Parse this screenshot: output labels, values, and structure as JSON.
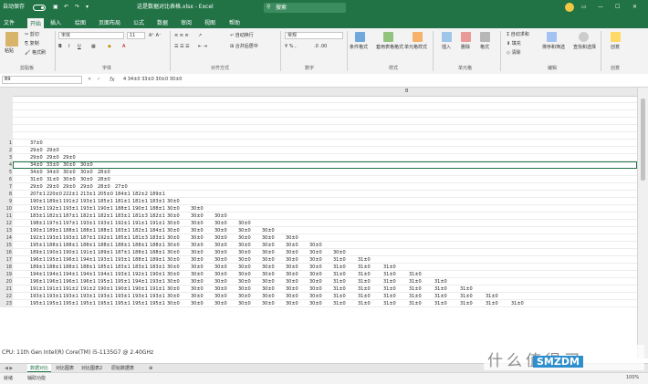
{
  "window": {
    "title_left": "自动保存",
    "title_center": "这是数据对比表格.xlsx - Excel",
    "search_placeholder": "搜索",
    "colors": {
      "brand": "#217346",
      "accent": "#f2c744"
    }
  },
  "menu": {
    "items": [
      "文件",
      "开始",
      "插入",
      "绘图",
      "页面布局",
      "公式",
      "数据",
      "审阅",
      "视图",
      "帮助"
    ],
    "active": "开始"
  },
  "ribbon": {
    "clipboard": {
      "paste": "粘贴",
      "cut": "剪切",
      "copy": "复制",
      "format_painter": "格式刷",
      "label": "剪贴板"
    },
    "font": {
      "name": "宋体",
      "size": "11",
      "label": "字体"
    },
    "alignment": {
      "wrap": "自动换行",
      "merge": "合并后居中",
      "label": "对齐方式"
    },
    "number": {
      "format": "常规",
      "label": "数字"
    },
    "styles": {
      "conditional": "条件格式",
      "table": "套用表格格式",
      "cell_styles": "单元格样式",
      "label": "样式"
    },
    "cells": {
      "insert": "插入",
      "delete": "删除",
      "format": "格式",
      "label": "单元格"
    },
    "editing": {
      "autosum": "自动求和",
      "fill": "填充",
      "clear": "清除",
      "sort": "排序和筛选",
      "find": "查找和选择",
      "label": "编辑"
    },
    "ideas": {
      "button": "创意",
      "label": "创意"
    }
  },
  "formula_bar": {
    "name_box": "B9",
    "fx": "fx",
    "formula": "4 34±0  33±0  30±0  30±0"
  },
  "column_header": "B",
  "rows": [
    {
      "n": "",
      "cells": []
    },
    {
      "n": "",
      "cells": []
    },
    {
      "n": "",
      "cells": []
    },
    {
      "n": "",
      "cells": []
    },
    {
      "n": "",
      "cells": []
    },
    {
      "n": "",
      "cells": []
    },
    {
      "n": "1",
      "cells": [
        "37±0"
      ]
    },
    {
      "n": "2",
      "cells": [
        "29±0",
        "29±0"
      ]
    },
    {
      "n": "3",
      "cells": [
        "29±0",
        "29±0",
        "29±0"
      ]
    },
    {
      "n": "4",
      "cells": [
        "34±0",
        "33±0",
        "30±0",
        "30±0"
      ]
    },
    {
      "n": "5",
      "cells": [
        "34±0",
        "34±0",
        "30±0",
        "30±0",
        "28±0"
      ]
    },
    {
      "n": "6",
      "cells": [
        "31±0",
        "31±0",
        "30±0",
        "30±0",
        "28±0"
      ]
    },
    {
      "n": "7",
      "cells": [
        "29±0",
        "29±0",
        "29±0",
        "29±0",
        "28±0",
        "27±0"
      ]
    },
    {
      "n": "8",
      "cells": [
        "207±1",
        "220±0",
        "222±1",
        "213±1",
        "205±0",
        "184±1",
        "182±2",
        "189±1"
      ]
    },
    {
      "n": "9",
      "cells": [
        "190±1",
        "189±1",
        "191±2",
        "193±1",
        "185±1",
        "181±1",
        "181±1",
        "183±1",
        "30±0"
      ]
    },
    {
      "n": "10",
      "cells": [
        "193±1",
        "192±1",
        "193±1",
        "193±1",
        "190±1",
        "188±1",
        "190±1",
        "188±1",
        "30±0",
        "30±0"
      ]
    },
    {
      "n": "11",
      "cells": [
        "183±1",
        "182±1",
        "187±1",
        "182±1",
        "182±1",
        "183±1",
        "181±3",
        "182±1",
        "30±0",
        "30±0",
        "30±0"
      ]
    },
    {
      "n": "12",
      "cells": [
        "198±1",
        "197±1",
        "197±1",
        "193±1",
        "193±1",
        "192±1",
        "191±1",
        "191±1",
        "30±0",
        "30±0",
        "30±0",
        "30±0"
      ]
    },
    {
      "n": "13",
      "cells": [
        "190±1",
        "189±1",
        "188±1",
        "188±1",
        "188±1",
        "183±1",
        "182±1",
        "184±1",
        "30±0",
        "30±0",
        "30±0",
        "30±0",
        "30±0"
      ]
    },
    {
      "n": "14",
      "cells": [
        "192±1",
        "193±1",
        "193±1",
        "187±1",
        "192±1",
        "185±1",
        "181±3",
        "183±1",
        "30±0",
        "30±0",
        "30±0",
        "30±0",
        "30±0",
        "30±0"
      ]
    },
    {
      "n": "15",
      "cells": [
        "195±1",
        "188±1",
        "188±1",
        "188±1",
        "188±1",
        "188±1",
        "188±1",
        "188±1",
        "30±0",
        "30±0",
        "30±0",
        "30±0",
        "30±0",
        "30±0",
        "30±0"
      ]
    },
    {
      "n": "16",
      "cells": [
        "189±1",
        "190±1",
        "190±1",
        "191±1",
        "189±1",
        "187±1",
        "188±1",
        "188±1",
        "30±0",
        "30±0",
        "30±0",
        "30±0",
        "30±0",
        "30±0",
        "30±0",
        "30±0"
      ]
    },
    {
      "n": "17",
      "cells": [
        "196±1",
        "195±1",
        "196±1",
        "194±1",
        "193±1",
        "193±1",
        "188±1",
        "189±1",
        "30±0",
        "30±0",
        "30±0",
        "30±0",
        "30±0",
        "30±0",
        "30±0",
        "31±0",
        "31±0"
      ]
    },
    {
      "n": "18",
      "cells": [
        "189±1",
        "188±1",
        "188±1",
        "188±1",
        "185±1",
        "183±1",
        "183±1",
        "183±1",
        "30±0",
        "30±0",
        "30±0",
        "30±0",
        "30±0",
        "30±0",
        "30±0",
        "31±0",
        "31±0",
        "31±0"
      ]
    },
    {
      "n": "19",
      "cells": [
        "194±1",
        "194±1",
        "194±1",
        "194±1",
        "194±1",
        "193±1",
        "192±1",
        "190±1",
        "30±0",
        "30±0",
        "30±0",
        "30±0",
        "30±0",
        "30±0",
        "30±0",
        "31±0",
        "31±0",
        "31±0",
        "31±0"
      ]
    },
    {
      "n": "20",
      "cells": [
        "196±1",
        "196±1",
        "196±1",
        "196±1",
        "195±1",
        "195±1",
        "194±1",
        "193±1",
        "30±0",
        "30±0",
        "30±0",
        "30±0",
        "30±0",
        "30±0",
        "30±0",
        "31±0",
        "31±0",
        "31±0",
        "31±0",
        "31±0"
      ]
    },
    {
      "n": "21",
      "cells": [
        "191±1",
        "191±1",
        "191±2",
        "191±2",
        "190±1",
        "190±1",
        "190±1",
        "191±1",
        "30±0",
        "30±0",
        "30±0",
        "30±0",
        "30±0",
        "30±0",
        "30±0",
        "31±0",
        "31±0",
        "31±0",
        "31±0",
        "31±0",
        "31±0"
      ]
    },
    {
      "n": "22",
      "cells": [
        "193±1",
        "193±1",
        "193±1",
        "193±1",
        "193±1",
        "193±1",
        "193±1",
        "193±1",
        "30±0",
        "30±0",
        "30±0",
        "30±0",
        "30±0",
        "30±0",
        "30±0",
        "31±0",
        "31±0",
        "31±0",
        "31±0",
        "31±0",
        "31±0",
        "31±0"
      ]
    },
    {
      "n": "23",
      "cells": [
        "195±1",
        "195±1",
        "195±1",
        "195±1",
        "195±1",
        "195±1",
        "195±1",
        "195±1",
        "30±0",
        "30±0",
        "30±0",
        "30±0",
        "30±0",
        "30±0",
        "30±0",
        "31±0",
        "31±0",
        "31±0",
        "31±0",
        "31±0",
        "31±0",
        "31±0",
        "31±0"
      ]
    }
  ],
  "cpu_line": "CPU: 11th Gen Intel(R) Core(TM) i5-1135G7 @ 2.40GHz",
  "sheet_tabs": {
    "items": [
      "数据对比",
      "对比图表",
      "对比图表2",
      "原始数据表"
    ],
    "active": "数据对比"
  },
  "status": {
    "ready": "就绪",
    "accessibility": "辅助功能",
    "zoom": "100%"
  },
  "watermark": {
    "text": "什么值得买",
    "logo": "SMZDM"
  }
}
